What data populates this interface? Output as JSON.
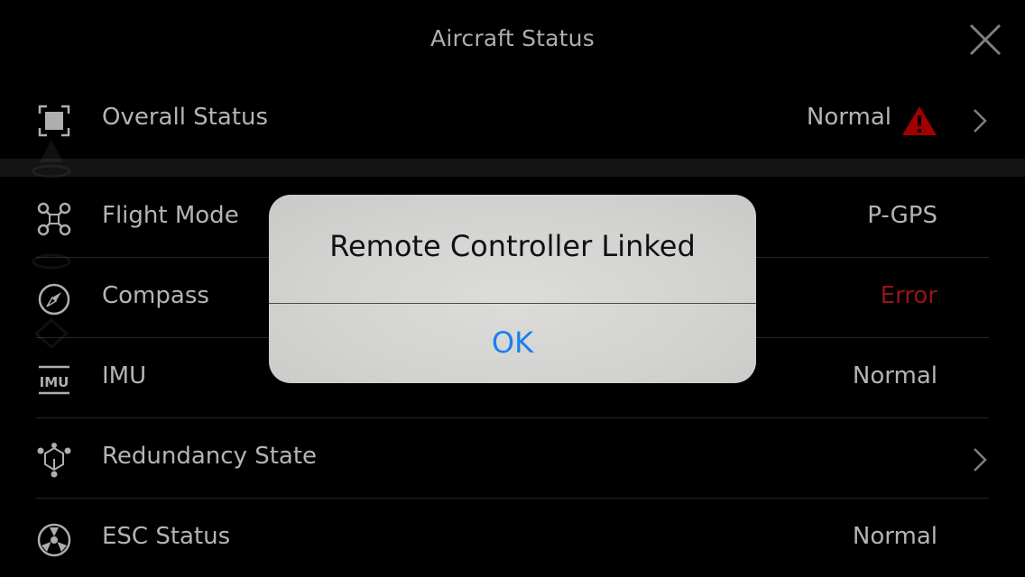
{
  "header": {
    "title": "Aircraft Status",
    "close_icon": "close-icon"
  },
  "rows": [
    {
      "label": "Overall Status",
      "value": "Normal",
      "icon": "overall-status-icon",
      "warning": true,
      "chevron": true
    },
    {
      "label": "Flight Mode",
      "value": "P-GPS",
      "icon": "drone-icon"
    },
    {
      "label": "Compass",
      "value": "Error",
      "icon": "compass-icon",
      "value_color": "#a31515"
    },
    {
      "label": "IMU",
      "value": "Normal",
      "icon": "imu-icon"
    },
    {
      "label": "Redundancy State",
      "value": "",
      "icon": "redundancy-icon",
      "chevron": true
    },
    {
      "label": "ESC Status",
      "value": "Normal",
      "icon": "esc-icon"
    }
  ],
  "dialog": {
    "title": "Remote Controller Linked",
    "button": "OK",
    "button_color": "#1a7ef0"
  },
  "colors": {
    "background": "#000000",
    "text": "#c4c4c4",
    "error": "#a31515",
    "warning": "#b00000"
  }
}
